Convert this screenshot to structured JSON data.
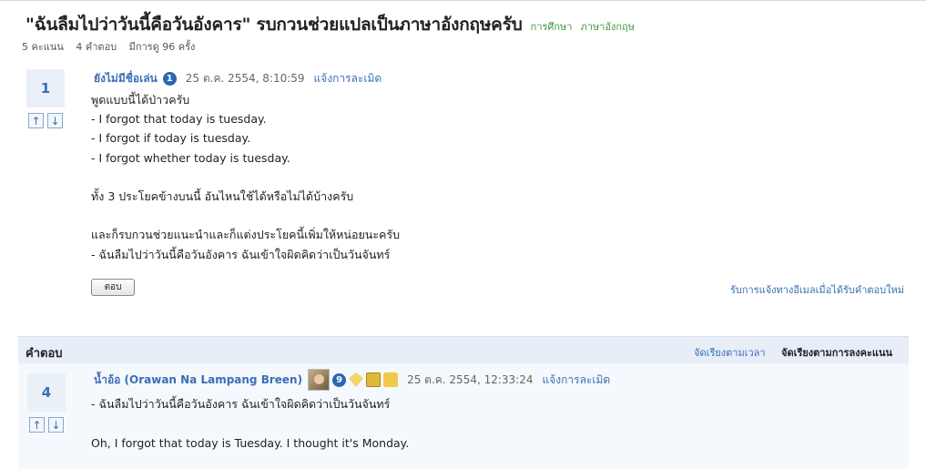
{
  "question": {
    "title": "\"ฉันลืมไปว่าวันนี้คือวันอังคาร\" รบกวนช่วยแปลเป็นภาษาอังกฤษครับ",
    "tags": [
      "การศึกษา",
      "ภาษาอังกฤษ"
    ],
    "stats": {
      "score": "5 คะแนน",
      "answers": "4 คำตอบ",
      "views": "มีการดู 96 ครั้ง"
    },
    "vote_count": "1",
    "author": "ยังไม่มีชื่อเล่น",
    "author_level": "1",
    "timestamp": "25 ต.ค. 2554, 8:10:59",
    "report_label": "แจ้งการละเมิด",
    "body_lines": [
      "พูดแบบนี้ได้ป่าวครับ",
      "- I forgot that today is tuesday.",
      "- I forgot if today is tuesday.",
      "- I forgot whether today is tuesday.",
      "",
      "ทั้ง 3 ประโยคข้างบนนี้ อันไหนใช้ได้หรือไม่ได้บ้างครับ",
      "",
      "และก็รบกวนช่วยแนะนำและก็แต่งประโยคนี้เพิ่มให้หน่อยนะครับ",
      "- ฉันลืมไปว่าวันนี้คือวันอังคาร ฉันเข้าใจผิดคิดว่าเป็นวันจันทร์"
    ],
    "reply_button": "ตอบ",
    "notify_link": "รับการแจ้งทางอีเมลเมื่อได้รับคำตอบใหม่"
  },
  "answers_section": {
    "label": "คำตอบ",
    "sort_time": "จัดเรียงตามเวลา",
    "sort_score": "จัดเรียงตามการลงคะแนน"
  },
  "answer": {
    "vote_count": "4",
    "author": "น้ำอ้อ (Orawan Na Lampang Breen)",
    "author_level": "9",
    "timestamp": "25 ต.ค. 2554, 12:33:24",
    "report_label": "แจ้งการละเมิด",
    "body_lines": [
      "- ฉันลืมไปว่าวันนี้คือวันอังคาร ฉันเข้าใจผิดคิดว่าเป็นวันจันทร์",
      "",
      "Oh, I forgot that today is Tuesday.  I thought it's Monday."
    ]
  },
  "icons": {
    "vote_up": "arrow-up-icon",
    "vote_down": "arrow-down-icon",
    "badges": [
      "diamond-badge-icon",
      "book-badge-icon",
      "lock-badge-icon"
    ]
  },
  "colors": {
    "link": "#3a6fb5",
    "tag": "#3d9a3d",
    "badge": "#2b67b4",
    "answers_bar": "#e7eef8"
  }
}
